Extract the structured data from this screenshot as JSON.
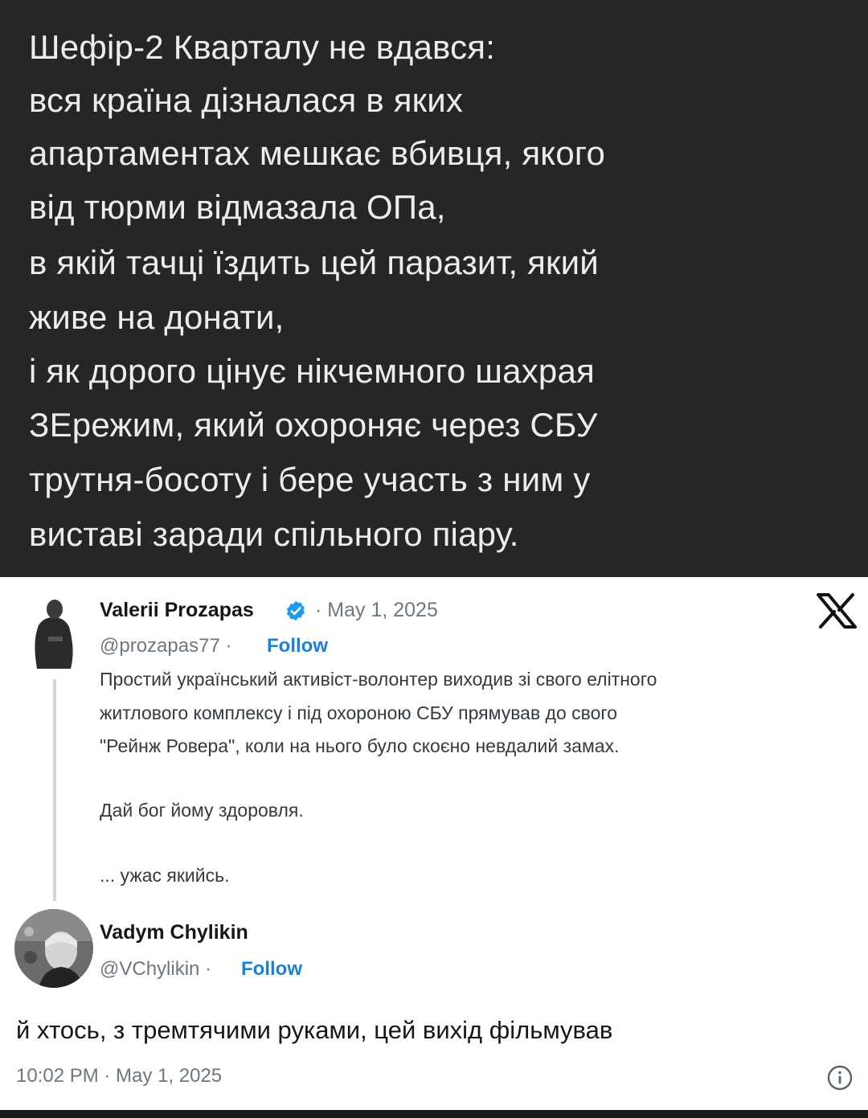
{
  "top_post": {
    "lines": [
      "Шефір-2 Кварталу не вдався:",
      "вся країна дізналася в яких",
      "апартаментах мешкає вбивця, якого",
      "від тюрми відмазала ОПа,",
      "в якій тачці їздить цей паразит, який",
      "живе на донати,",
      "і як дорого цінує нікчемного шахрая",
      "ЗЕрежим, який охороняє через СБУ",
      "трутня-босоту і бере участь з ним у",
      "виставі заради спільного піару."
    ]
  },
  "tweet": {
    "author_name": "Valerii Prozapas",
    "date": "· May 1, 2025",
    "handle": "@prozapas77 ·",
    "follow_label": "Follow",
    "body_lines": [
      "Простий український активіст-волонтер виходив зі свого елітного",
      "житлового комплексу і під охороною СБУ прямував до свого",
      "\"Рейнж Ровера\", коли на нього було скоєно невдалий замах.",
      "Дай бог йому здоровля.",
      "... ужас якийсь."
    ]
  },
  "reply": {
    "author_name": "Vadym Chylikin",
    "handle": "@VChylikin ·",
    "follow_label": "Follow",
    "text": "й хтось, з тремтячими руками, цей вихід фільмував",
    "timestamp": "10:02 PM · May 1, 2025"
  },
  "icons": {
    "verified": "verified-badge-icon",
    "x_logo": "x-logo-icon",
    "info": "info-icon"
  },
  "colors": {
    "top_background": "#262626",
    "top_text": "#ededed",
    "follow": "#1d7fd4",
    "verified": "#1d9bf0"
  }
}
